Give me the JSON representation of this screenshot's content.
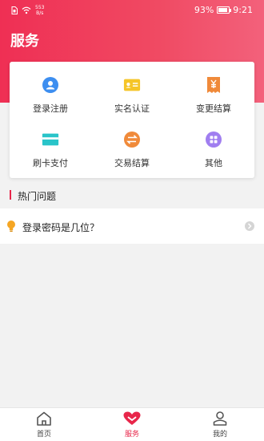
{
  "status_bar": {
    "speed_value": "553",
    "speed_unit": "B/s",
    "battery": "93%",
    "time": "9:21",
    "battery_level": 0.93
  },
  "header": {
    "title": "服务"
  },
  "services": [
    {
      "label": "登录注册",
      "icon": "user-badge-icon",
      "color": "#3d8ef0"
    },
    {
      "label": "实名认证",
      "icon": "id-card-icon",
      "color": "#f5c528"
    },
    {
      "label": "变更结算",
      "icon": "yuan-receipt-icon",
      "color": "#f08a3a"
    },
    {
      "label": "刷卡支付",
      "icon": "bank-card-icon",
      "color": "#29c4c9"
    },
    {
      "label": "交易结算",
      "icon": "exchange-icon",
      "color": "#f08a3a"
    },
    {
      "label": "其他",
      "icon": "grid-more-icon",
      "color": "#a07ef0"
    }
  ],
  "section": {
    "title": "热门问题"
  },
  "faq": [
    {
      "question": "登录密码是几位？"
    }
  ],
  "bottom_nav": [
    {
      "label": "首页",
      "icon": "home-icon"
    },
    {
      "label": "服务",
      "icon": "heart-icon"
    },
    {
      "label": "我的",
      "icon": "person-icon"
    }
  ],
  "colors": {
    "accent": "#e8264a",
    "header_start": "#ef2f54",
    "header_end": "#f3617b"
  }
}
